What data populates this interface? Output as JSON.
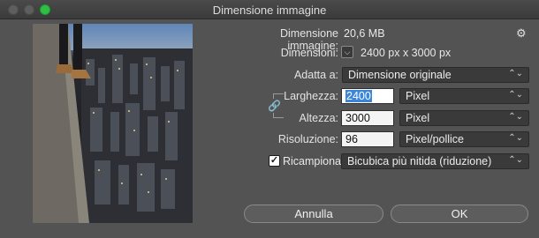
{
  "window": {
    "title": "Dimensione immagine"
  },
  "header": {
    "size_label": "Dimensione immagine:",
    "size_value": "20,6 MB"
  },
  "dimensions": {
    "label": "Dimensioni:",
    "value": "2400 px x 3000 px",
    "toggle_glyph": "⌵"
  },
  "fit": {
    "label": "Adatta a:",
    "value": "Dimensione originale"
  },
  "width": {
    "label": "Larghezza:",
    "value": "2400",
    "unit": "Pixel"
  },
  "height": {
    "label": "Altezza:",
    "value": "3000",
    "unit": "Pixel"
  },
  "resolution": {
    "label": "Risoluzione:",
    "value": "96",
    "unit": "Pixel/pollice"
  },
  "resample": {
    "checked": true,
    "check_glyph": "✓",
    "label": "Ricampiona:",
    "value": "Bicubica più nitida (riduzione)"
  },
  "buttons": {
    "cancel": "Annulla",
    "ok": "OK"
  },
  "icons": {
    "gear": "gear-icon",
    "chain_link": "chain-link-icon",
    "chevron": "chevron-updown-icon"
  },
  "glyphs": {
    "gear": "⚙",
    "chain": "🔗",
    "chevron": "⌃⌄"
  },
  "colors": {
    "dialog_bg": "#535353",
    "selection": "#3c86d9",
    "maximize_green": "#2fbf43"
  }
}
